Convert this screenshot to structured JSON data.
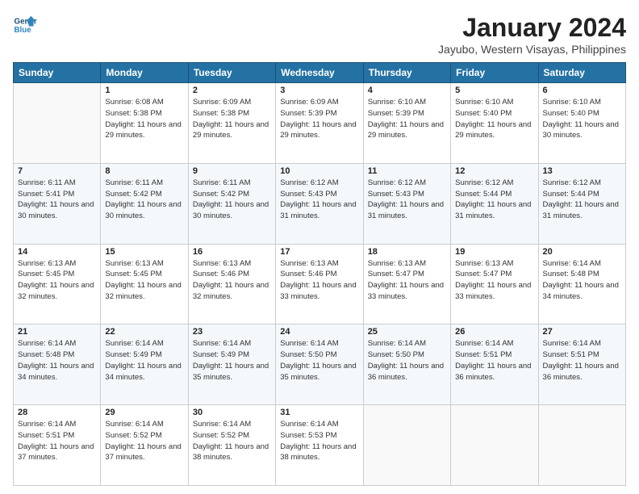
{
  "header": {
    "logo_line1": "General",
    "logo_line2": "Blue",
    "title": "January 2024",
    "subtitle": "Jayubo, Western Visayas, Philippines"
  },
  "days_of_week": [
    "Sunday",
    "Monday",
    "Tuesday",
    "Wednesday",
    "Thursday",
    "Friday",
    "Saturday"
  ],
  "weeks": [
    [
      {
        "day": "",
        "sunrise": "",
        "sunset": "",
        "daylight": ""
      },
      {
        "day": "1",
        "sunrise": "6:08 AM",
        "sunset": "5:38 PM",
        "daylight": "11 hours and 29 minutes."
      },
      {
        "day": "2",
        "sunrise": "6:09 AM",
        "sunset": "5:38 PM",
        "daylight": "11 hours and 29 minutes."
      },
      {
        "day": "3",
        "sunrise": "6:09 AM",
        "sunset": "5:39 PM",
        "daylight": "11 hours and 29 minutes."
      },
      {
        "day": "4",
        "sunrise": "6:10 AM",
        "sunset": "5:39 PM",
        "daylight": "11 hours and 29 minutes."
      },
      {
        "day": "5",
        "sunrise": "6:10 AM",
        "sunset": "5:40 PM",
        "daylight": "11 hours and 29 minutes."
      },
      {
        "day": "6",
        "sunrise": "6:10 AM",
        "sunset": "5:40 PM",
        "daylight": "11 hours and 30 minutes."
      }
    ],
    [
      {
        "day": "7",
        "sunrise": "6:11 AM",
        "sunset": "5:41 PM",
        "daylight": "11 hours and 30 minutes."
      },
      {
        "day": "8",
        "sunrise": "6:11 AM",
        "sunset": "5:42 PM",
        "daylight": "11 hours and 30 minutes."
      },
      {
        "day": "9",
        "sunrise": "6:11 AM",
        "sunset": "5:42 PM",
        "daylight": "11 hours and 30 minutes."
      },
      {
        "day": "10",
        "sunrise": "6:12 AM",
        "sunset": "5:43 PM",
        "daylight": "11 hours and 31 minutes."
      },
      {
        "day": "11",
        "sunrise": "6:12 AM",
        "sunset": "5:43 PM",
        "daylight": "11 hours and 31 minutes."
      },
      {
        "day": "12",
        "sunrise": "6:12 AM",
        "sunset": "5:44 PM",
        "daylight": "11 hours and 31 minutes."
      },
      {
        "day": "13",
        "sunrise": "6:12 AM",
        "sunset": "5:44 PM",
        "daylight": "11 hours and 31 minutes."
      }
    ],
    [
      {
        "day": "14",
        "sunrise": "6:13 AM",
        "sunset": "5:45 PM",
        "daylight": "11 hours and 32 minutes."
      },
      {
        "day": "15",
        "sunrise": "6:13 AM",
        "sunset": "5:45 PM",
        "daylight": "11 hours and 32 minutes."
      },
      {
        "day": "16",
        "sunrise": "6:13 AM",
        "sunset": "5:46 PM",
        "daylight": "11 hours and 32 minutes."
      },
      {
        "day": "17",
        "sunrise": "6:13 AM",
        "sunset": "5:46 PM",
        "daylight": "11 hours and 33 minutes."
      },
      {
        "day": "18",
        "sunrise": "6:13 AM",
        "sunset": "5:47 PM",
        "daylight": "11 hours and 33 minutes."
      },
      {
        "day": "19",
        "sunrise": "6:13 AM",
        "sunset": "5:47 PM",
        "daylight": "11 hours and 33 minutes."
      },
      {
        "day": "20",
        "sunrise": "6:14 AM",
        "sunset": "5:48 PM",
        "daylight": "11 hours and 34 minutes."
      }
    ],
    [
      {
        "day": "21",
        "sunrise": "6:14 AM",
        "sunset": "5:48 PM",
        "daylight": "11 hours and 34 minutes."
      },
      {
        "day": "22",
        "sunrise": "6:14 AM",
        "sunset": "5:49 PM",
        "daylight": "11 hours and 34 minutes."
      },
      {
        "day": "23",
        "sunrise": "6:14 AM",
        "sunset": "5:49 PM",
        "daylight": "11 hours and 35 minutes."
      },
      {
        "day": "24",
        "sunrise": "6:14 AM",
        "sunset": "5:50 PM",
        "daylight": "11 hours and 35 minutes."
      },
      {
        "day": "25",
        "sunrise": "6:14 AM",
        "sunset": "5:50 PM",
        "daylight": "11 hours and 36 minutes."
      },
      {
        "day": "26",
        "sunrise": "6:14 AM",
        "sunset": "5:51 PM",
        "daylight": "11 hours and 36 minutes."
      },
      {
        "day": "27",
        "sunrise": "6:14 AM",
        "sunset": "5:51 PM",
        "daylight": "11 hours and 36 minutes."
      }
    ],
    [
      {
        "day": "28",
        "sunrise": "6:14 AM",
        "sunset": "5:51 PM",
        "daylight": "11 hours and 37 minutes."
      },
      {
        "day": "29",
        "sunrise": "6:14 AM",
        "sunset": "5:52 PM",
        "daylight": "11 hours and 37 minutes."
      },
      {
        "day": "30",
        "sunrise": "6:14 AM",
        "sunset": "5:52 PM",
        "daylight": "11 hours and 38 minutes."
      },
      {
        "day": "31",
        "sunrise": "6:14 AM",
        "sunset": "5:53 PM",
        "daylight": "11 hours and 38 minutes."
      },
      {
        "day": "",
        "sunrise": "",
        "sunset": "",
        "daylight": ""
      },
      {
        "day": "",
        "sunrise": "",
        "sunset": "",
        "daylight": ""
      },
      {
        "day": "",
        "sunrise": "",
        "sunset": "",
        "daylight": ""
      }
    ]
  ]
}
